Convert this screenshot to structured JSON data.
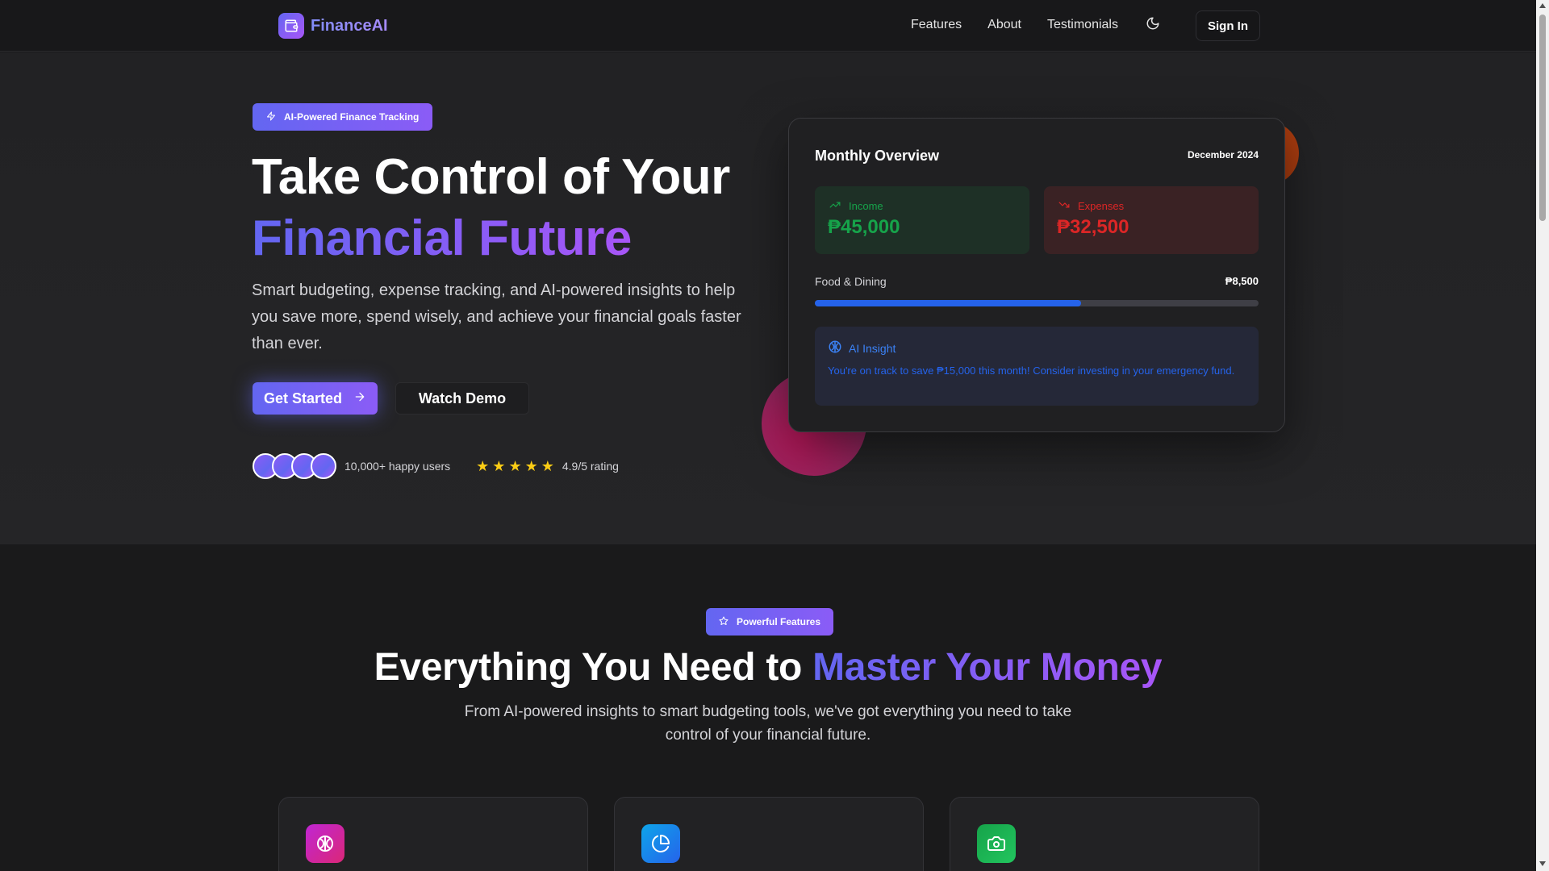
{
  "nav": {
    "logo_text": "FinanceAI",
    "links": [
      "Features",
      "About",
      "Testimonials"
    ],
    "sign_in": "Sign In"
  },
  "hero": {
    "badge": "AI-Powered Finance Tracking",
    "title_line1": "Take Control of Your",
    "title_line2": "Financial Future",
    "subtitle": "Smart budgeting, expense tracking, and AI-powered insights to help you save more, spend wisely, and achieve your financial goals faster than ever.",
    "primary_button": "Get Started",
    "secondary_button": "Watch Demo",
    "users_text": "10,000+ happy users",
    "stars": 5,
    "rating_text": "4.9/5 rating"
  },
  "overview": {
    "title": "Monthly Overview",
    "date": "December 2024",
    "income_label": "Income",
    "income_value": "₱45,000",
    "expense_label": "Expenses",
    "expense_value": "₱32,500",
    "category_label": "Food & Dining",
    "category_amount": "₱8,500",
    "category_progress": 0.6,
    "insight_title": "AI Insight",
    "insight_text": "You're on track to save ₱15,000 this month! Consider investing in your emergency fund."
  },
  "features": {
    "badge": "Powerful Features",
    "title_plain": "Everything You Need to ",
    "title_grad": "Master Your Money",
    "subtitle": "From AI-powered insights to smart budgeting tools, we've got everything you need to take control of your financial future.",
    "cards": [
      {
        "icon": "brain-icon",
        "color": "#c026d3"
      },
      {
        "icon": "pie-chart-icon",
        "color": "#0ea5e9"
      },
      {
        "icon": "camera-icon",
        "color": "#16a34a"
      }
    ]
  },
  "colors": {
    "accent": "#6366f1",
    "accent2": "#8b5cf6",
    "income": "#16a34a",
    "expense": "#dc2626",
    "progress": "#2563eb"
  }
}
